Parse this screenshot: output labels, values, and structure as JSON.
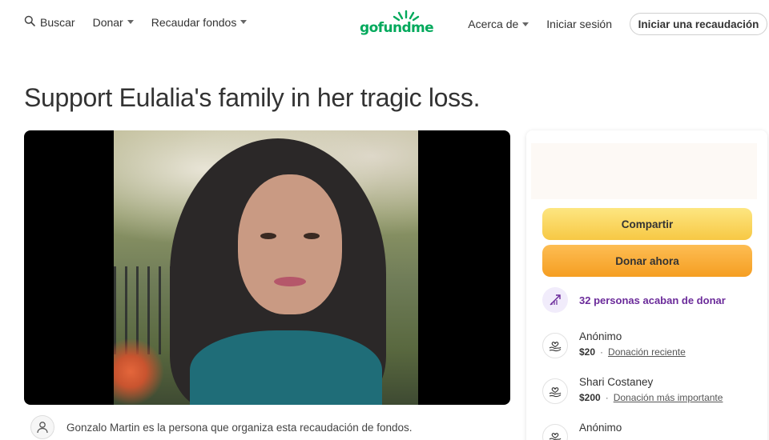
{
  "header": {
    "search_label": "Buscar",
    "donate_label": "Donar",
    "raise_label": "Recaudar fondos",
    "logo_text": "gofundme",
    "about_label": "Acerca de",
    "signin_label": "Iniciar sesión",
    "start_label": "Iniciar una recaudación"
  },
  "page": {
    "title": "Support Eulalia's family in her tragic loss."
  },
  "organizer": {
    "text": "Gonzalo Martin es la persona que organiza esta recaudación de fondos."
  },
  "sidebar": {
    "share_label": "Compartir",
    "donate_now_label": "Donar ahora",
    "recent_count_text": "32 personas acaban de donar",
    "donations": [
      {
        "name": "Anónimo",
        "amount": "$20",
        "tag": "Donación reciente"
      },
      {
        "name": "Shari Costaney",
        "amount": "$200",
        "tag": "Donación más importante"
      },
      {
        "name": "Anónimo",
        "amount": "",
        "tag": ""
      }
    ]
  },
  "colors": {
    "brand_green": "#02a95c",
    "share_yellow": "#f9d75b",
    "donate_orange": "#f7aa3a",
    "recent_purple": "#6b2b9a"
  },
  "icons": {
    "search": "search-icon",
    "trend": "trending-up-icon",
    "donor": "heart-hand-icon",
    "organizer": "user-icon"
  }
}
